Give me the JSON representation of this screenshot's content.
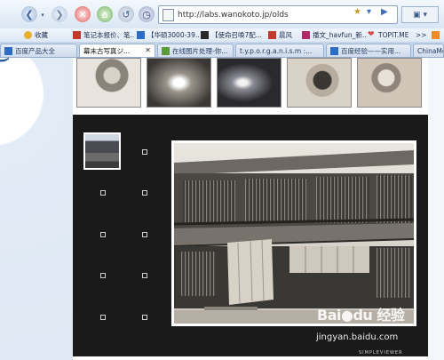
{
  "toolbar": {
    "address": "http://labs.wanokoto.jp/olds",
    "back_icon": "back-arrow-icon",
    "forward_icon": "forward-arrow-icon",
    "stop_icon": "stop-icon",
    "home_icon": "home-icon",
    "undo_icon": "undo-icon",
    "history_icon": "history-icon"
  },
  "favorites": [
    {
      "label": "收藏",
      "color": "#e8b030"
    },
    {
      "label": "笔记本报价、笔...",
      "color": "#c43a2a"
    },
    {
      "label": "【华硕3000-39...",
      "color": "#2c6cc4"
    },
    {
      "label": "【使命召唤7配...",
      "color": "#2a2a2a"
    },
    {
      "label": "晨风",
      "color": "#c43a2a"
    },
    {
      "label": "播文_havfun_新...",
      "color": "#b02a6a"
    },
    {
      "label": "TOPIT.ME",
      "color": "#d04848"
    },
    {
      "label": ">>",
      "color": "#ffffff"
    }
  ],
  "tabs": [
    {
      "label": "百度产品大全",
      "active": false
    },
    {
      "label": "幕末古写真ジ...",
      "active": true
    },
    {
      "label": "在线图片处理-你...",
      "active": false
    },
    {
      "label": "t.y.p.o.r.g.a.n.i.s.m :...",
      "active": false
    },
    {
      "label": "百度经验——实用...",
      "active": false
    },
    {
      "label": "ChinaMob...",
      "active": false
    }
  ],
  "watermark": {
    "brand": "Bai●du 经验",
    "site": "jingyan.baidu.com",
    "viewer": "SIMPLEVIEWER"
  }
}
